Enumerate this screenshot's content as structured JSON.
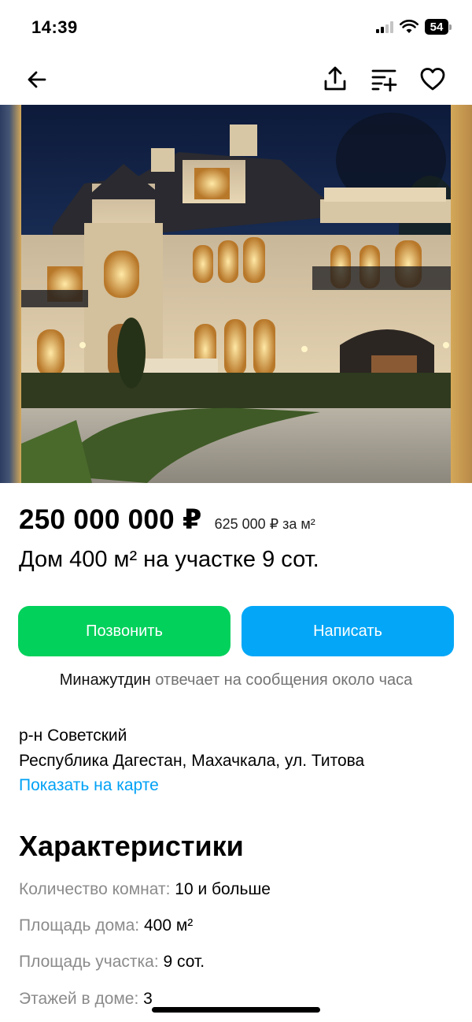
{
  "status_bar": {
    "time": "14:39",
    "battery": "54"
  },
  "listing": {
    "price": "250 000 000 ₽",
    "price_per_m2": "625 000 ₽ за м²",
    "title": "Дом 400 м² на участке 9 сот."
  },
  "actions": {
    "call_label": "Позвонить",
    "write_label": "Написать"
  },
  "seller": {
    "name": "Минажутдин",
    "note": "отвечает на сообщения около часа"
  },
  "address": {
    "district": "р-н Советский",
    "full": "Республика Дагестан, Махачкала, ул. Титова",
    "map_link": "Показать на карте"
  },
  "characteristics": {
    "title": "Характеристики",
    "items": [
      {
        "label": "Количество комнат:",
        "value": "10 и больше"
      },
      {
        "label": "Площадь дома:",
        "value": "400 м²"
      },
      {
        "label": "Площадь участка:",
        "value": "9 сот."
      },
      {
        "label": "Этажей в доме:",
        "value": "3"
      }
    ]
  },
  "colors": {
    "call_button": "#02d15c",
    "write_button": "#04a7f7",
    "link": "#00a1f5",
    "muted_text": "#8b8b8b"
  },
  "icons": [
    "back-arrow-icon",
    "share-icon",
    "compare-icon",
    "favorite-heart-icon"
  ]
}
